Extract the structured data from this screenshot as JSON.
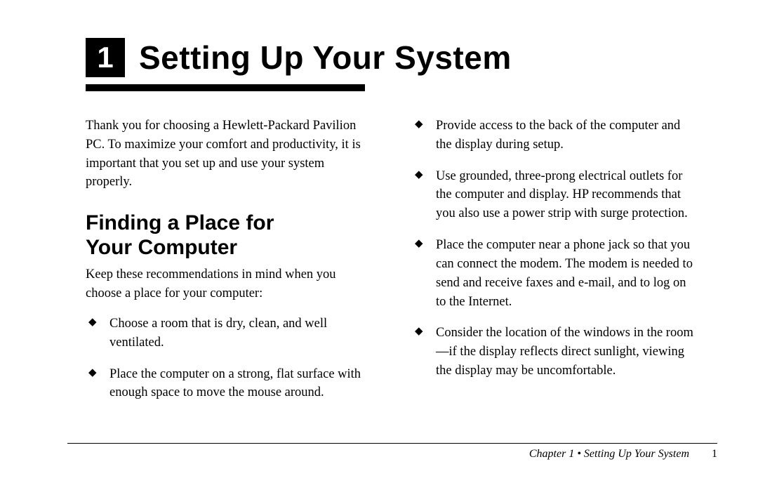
{
  "chapter": {
    "number": "1",
    "title": "Setting Up Your System"
  },
  "intro": "Thank you for choosing a Hewlett-Packard Pavilion PC. To maximize your comfort and productivity, it is important that you set up and use your system properly.",
  "section": {
    "heading_line1": "Finding a Place for",
    "heading_line2": "Your Computer",
    "lead": "Keep these recommendations in mind when you choose a place for your computer:"
  },
  "bullets_left": [
    "Choose a room that is dry, clean, and well ventilated.",
    "Place the computer on a strong, flat surface with enough space to move the mouse around."
  ],
  "bullets_right": [
    "Provide access to the back of the computer and the display during setup.",
    "Use grounded, three-prong electrical outlets for the computer and display. HP recommends that you also use a power strip with surge protection.",
    "Place the computer near a phone jack so that you can connect the modem. The modem is needed to send and receive faxes and e-mail, and to log on to the Internet.",
    "Consider the location of the windows in the room—if the display reflects direct sunlight, viewing the display may be uncomfortable."
  ],
  "footer": {
    "label": "Chapter 1  •  Setting Up Your System",
    "page": "1"
  }
}
